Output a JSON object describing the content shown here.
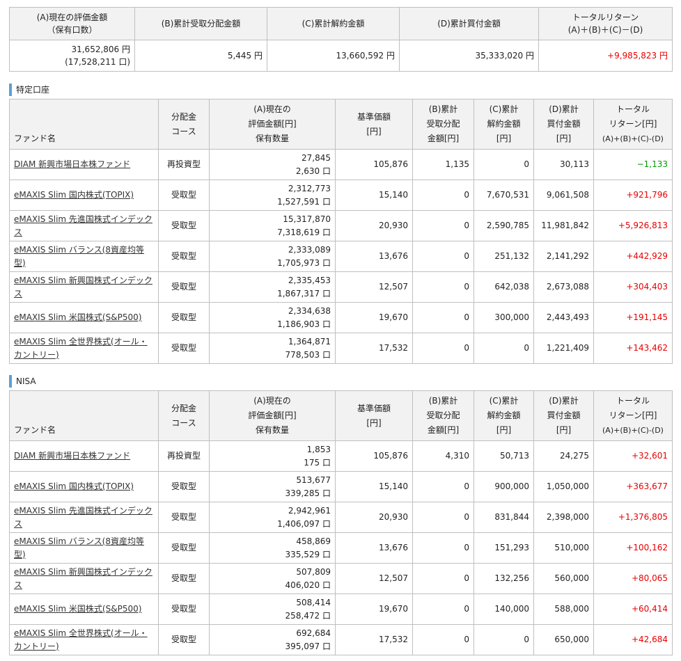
{
  "summary": {
    "headers": [
      [
        "(A)現在の評価金額",
        "（保有口数）"
      ],
      [
        "(B)累計受取分配金額"
      ],
      [
        "(C)累計解約金額"
      ],
      [
        "(D)累計買付金額"
      ],
      [
        "トータルリターン",
        "(A)＋(B)＋(C)－(D)"
      ]
    ],
    "values": {
      "a_value": "31,652,806 円",
      "a_units": "(17,528,211 口)",
      "b": "5,445 円",
      "c": "13,660,592 円",
      "d": "35,333,020 円",
      "total": "+9,985,823 円"
    }
  },
  "table_headers": {
    "fund_name": "ファンド名",
    "course": [
      "分配金",
      "コース"
    ],
    "a": [
      "(A)現在の",
      "評価金額[円]",
      "保有数量"
    ],
    "base": [
      "基準価額",
      "[円]"
    ],
    "b": [
      "(B)累計",
      "受取分配",
      "金額[円]"
    ],
    "c": [
      "(C)累計",
      "解約金額",
      "[円]"
    ],
    "d": [
      "(D)累計",
      "買付金額",
      "[円]"
    ],
    "total": [
      "トータル",
      "リターン[円]",
      "(A)+(B)+(C)-(D)"
    ]
  },
  "colors": {
    "positive": "#e60000",
    "negative": "#009900",
    "section_bar": "#5aa0d8"
  },
  "sections": [
    {
      "title": "特定口座",
      "rows": [
        {
          "name": "DIAM 新興市場日本株ファンド",
          "course": "再投資型",
          "value": "27,845",
          "units": "2,630 口",
          "base": "105,876",
          "b": "1,135",
          "c": "0",
          "d": "30,113",
          "total": "−1,133",
          "sign": "neg"
        },
        {
          "name": "eMAXIS Slim 国内株式(TOPIX)",
          "course": "受取型",
          "value": "2,312,773",
          "units": "1,527,591 口",
          "base": "15,140",
          "b": "0",
          "c": "7,670,531",
          "d": "9,061,508",
          "total": "+921,796",
          "sign": "pos"
        },
        {
          "name": "eMAXIS Slim 先進国株式インデックス",
          "course": "受取型",
          "value": "15,317,870",
          "units": "7,318,619 口",
          "base": "20,930",
          "b": "0",
          "c": "2,590,785",
          "d": "11,981,842",
          "total": "+5,926,813",
          "sign": "pos"
        },
        {
          "name": "eMAXIS Slim バランス(8資産均等型)",
          "course": "受取型",
          "value": "2,333,089",
          "units": "1,705,973 口",
          "base": "13,676",
          "b": "0",
          "c": "251,132",
          "d": "2,141,292",
          "total": "+442,929",
          "sign": "pos"
        },
        {
          "name": "eMAXIS Slim 新興国株式インデックス",
          "course": "受取型",
          "value": "2,335,453",
          "units": "1,867,317 口",
          "base": "12,507",
          "b": "0",
          "c": "642,038",
          "d": "2,673,088",
          "total": "+304,403",
          "sign": "pos"
        },
        {
          "name": "eMAXIS Slim 米国株式(S&P500)",
          "course": "受取型",
          "value": "2,334,638",
          "units": "1,186,903 口",
          "base": "19,670",
          "b": "0",
          "c": "300,000",
          "d": "2,443,493",
          "total": "+191,145",
          "sign": "pos"
        },
        {
          "name": "eMAXIS Slim 全世界株式(オール・カントリー)",
          "course": "受取型",
          "value": "1,364,871",
          "units": "778,503 口",
          "base": "17,532",
          "b": "0",
          "c": "0",
          "d": "1,221,409",
          "total": "+143,462",
          "sign": "pos"
        }
      ]
    },
    {
      "title": "NISA",
      "rows": [
        {
          "name": "DIAM 新興市場日本株ファンド",
          "course": "再投資型",
          "value": "1,853",
          "units": "175 口",
          "base": "105,876",
          "b": "4,310",
          "c": "50,713",
          "d": "24,275",
          "total": "+32,601",
          "sign": "pos"
        },
        {
          "name": "eMAXIS Slim 国内株式(TOPIX)",
          "course": "受取型",
          "value": "513,677",
          "units": "339,285 口",
          "base": "15,140",
          "b": "0",
          "c": "900,000",
          "d": "1,050,000",
          "total": "+363,677",
          "sign": "pos"
        },
        {
          "name": "eMAXIS Slim 先進国株式インデックス",
          "course": "受取型",
          "value": "2,942,961",
          "units": "1,406,097 口",
          "base": "20,930",
          "b": "0",
          "c": "831,844",
          "d": "2,398,000",
          "total": "+1,376,805",
          "sign": "pos"
        },
        {
          "name": "eMAXIS Slim バランス(8資産均等型)",
          "course": "受取型",
          "value": "458,869",
          "units": "335,529 口",
          "base": "13,676",
          "b": "0",
          "c": "151,293",
          "d": "510,000",
          "total": "+100,162",
          "sign": "pos"
        },
        {
          "name": "eMAXIS Slim 新興国株式インデックス",
          "course": "受取型",
          "value": "507,809",
          "units": "406,020 口",
          "base": "12,507",
          "b": "0",
          "c": "132,256",
          "d": "560,000",
          "total": "+80,065",
          "sign": "pos"
        },
        {
          "name": "eMAXIS Slim 米国株式(S&P500)",
          "course": "受取型",
          "value": "508,414",
          "units": "258,472 口",
          "base": "19,670",
          "b": "0",
          "c": "140,000",
          "d": "588,000",
          "total": "+60,414",
          "sign": "pos"
        },
        {
          "name": "eMAXIS Slim 全世界株式(オール・カントリー)",
          "course": "受取型",
          "value": "692,684",
          "units": "395,097 口",
          "base": "17,532",
          "b": "0",
          "c": "0",
          "d": "650,000",
          "total": "+42,684",
          "sign": "pos"
        }
      ]
    }
  ]
}
